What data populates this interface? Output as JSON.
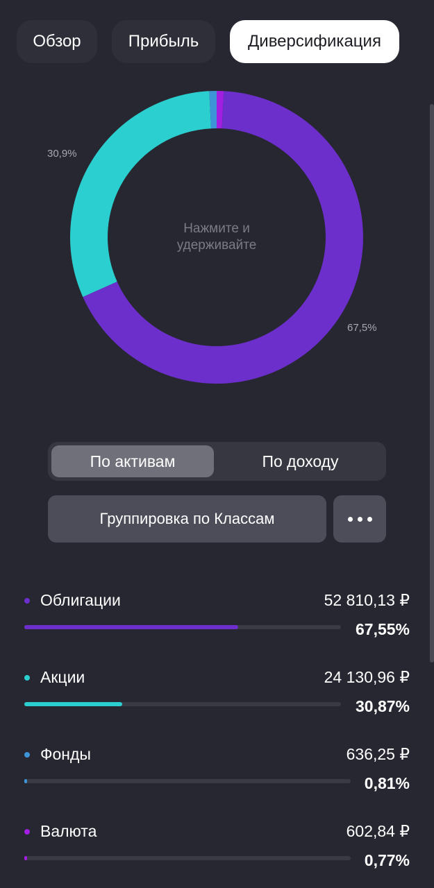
{
  "tabs": [
    {
      "label": "Обзор",
      "active": false
    },
    {
      "label": "Прибыль",
      "active": false
    },
    {
      "label": "Диверсификация",
      "active": true
    }
  ],
  "chart_data": {
    "type": "pie",
    "categories": [
      "Облигации",
      "Акции",
      "Фонды",
      "Валюта"
    ],
    "values": [
      67.55,
      30.87,
      0.81,
      0.77
    ],
    "colors": [
      "#6c2fcb",
      "#2ccfcf",
      "#3d94d6",
      "#a21ee0"
    ],
    "slice_labels": [
      "67,5%",
      "30,9%"
    ],
    "center_text_line1": "Нажмите и",
    "center_text_line2": "удерживайте"
  },
  "segmented": {
    "active_label": "По активам",
    "inactive_label": "По доходу"
  },
  "grouping_button": {
    "label": "Группировка по Классам"
  },
  "assets": [
    {
      "name": "Облигации",
      "amount": "52 810,13 ₽",
      "percent": "67,55%",
      "share": 0.6755,
      "color": "#6c2fcb"
    },
    {
      "name": "Акции",
      "amount": "24 130,96 ₽",
      "percent": "30,87%",
      "share": 0.3087,
      "color": "#2ccfcf"
    },
    {
      "name": "Фонды",
      "amount": "636,25 ₽",
      "percent": "0,81%",
      "share": 0.0081,
      "color": "#3d94d6"
    },
    {
      "name": "Валюта",
      "amount": "602,84 ₽",
      "percent": "0,77%",
      "share": 0.0077,
      "color": "#a21ee0"
    }
  ]
}
